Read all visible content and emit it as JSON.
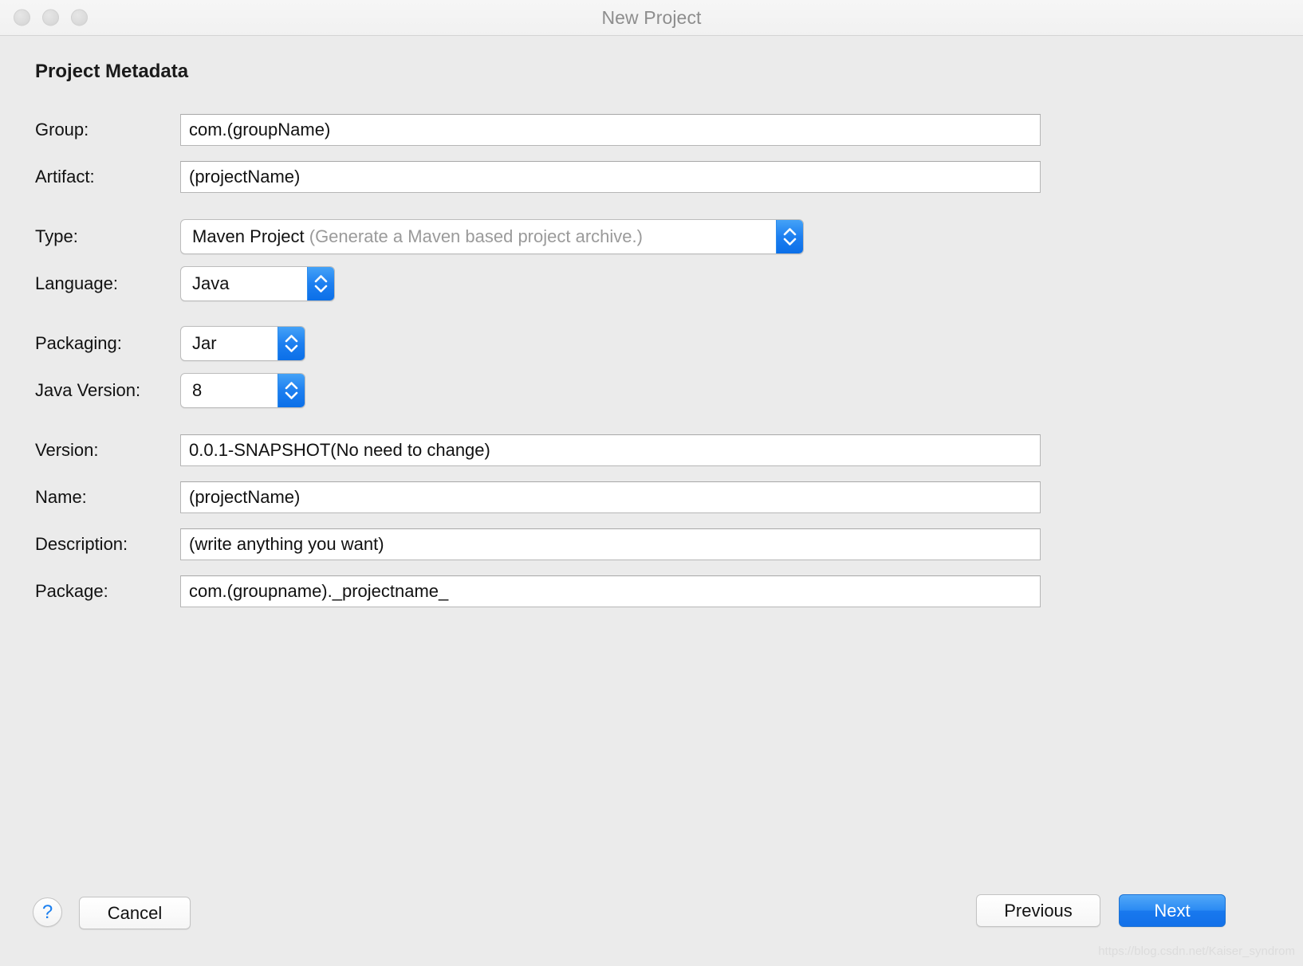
{
  "window": {
    "title": "New Project",
    "traffic_lights": [
      "close",
      "minimize",
      "zoom"
    ]
  },
  "section": {
    "title": "Project Metadata"
  },
  "fields": {
    "group": {
      "label": "Group:",
      "value": "com.(groupName)"
    },
    "artifact": {
      "label": "Artifact:",
      "value": "(projectName)"
    },
    "type": {
      "label": "Type:",
      "value": "Maven Project",
      "hint": " (Generate a Maven based project archive.)"
    },
    "language": {
      "label": "Language:",
      "value": "Java"
    },
    "packaging": {
      "label": "Packaging:",
      "value": "Jar"
    },
    "java_version": {
      "label": "Java Version:",
      "value": "8"
    },
    "version": {
      "label": "Version:",
      "value": "0.0.1-SNAPSHOT(No need to change)"
    },
    "name": {
      "label": "Name:",
      "value": "(projectName)"
    },
    "description": {
      "label": "Description:",
      "value": "(write anything you want)"
    },
    "package": {
      "label": "Package:",
      "value": "com.(groupname)._projectname_"
    }
  },
  "buttons": {
    "help": "?",
    "cancel": "Cancel",
    "previous": "Previous",
    "next": "Next"
  },
  "watermark": "https://blog.csdn.net/Kaiser_syndrom",
  "colors": {
    "accent_blue": "#1d7ff0",
    "window_bg": "#ebebeb",
    "titlebar_bg": "#f3f3f3",
    "field_bg": "#ffffff",
    "hint_text": "#9a9a9a"
  }
}
